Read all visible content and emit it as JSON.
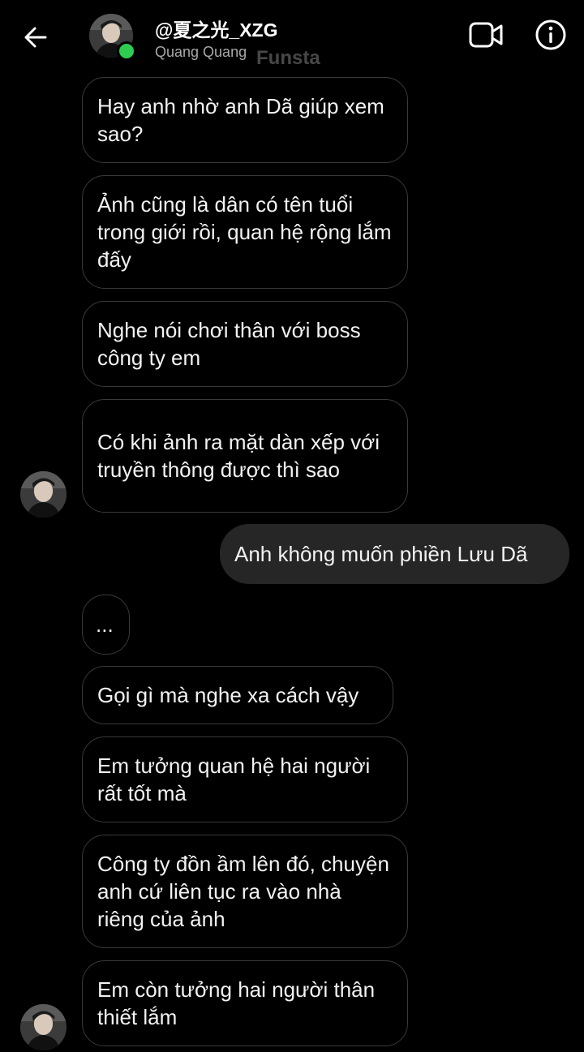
{
  "header": {
    "username": "@夏之光_XZG",
    "subtitle": "Quang Quang",
    "watermark": "Funsta",
    "back_icon": "arrow-left-icon",
    "video_icon": "video-camera-icon",
    "info_icon": "info-icon",
    "online_color": "#2ecc4f"
  },
  "messages": [
    {
      "side": "received",
      "text": "Hay anh nhờ anh Dã giúp xem sao?"
    },
    {
      "side": "received",
      "text": "Ảnh cũng là dân có tên tuổi trong giới rồi, quan hệ rộng lắm đấy"
    },
    {
      "side": "received",
      "text": "Nghe nói chơi thân với boss công ty em"
    },
    {
      "side": "received",
      "text": "Có khi ảnh ra mặt dàn xếp với truyền thông được thì sao"
    },
    {
      "side": "sent",
      "text": "Anh không muốn phiền Lưu Dã"
    },
    {
      "side": "received",
      "text": "..."
    },
    {
      "side": "received",
      "text": "Gọi gì mà nghe xa cách vậy"
    },
    {
      "side": "received",
      "text": "Em tưởng quan hệ hai người rất tốt mà"
    },
    {
      "side": "received",
      "text": "Công ty đồn ầm lên đó, chuyện anh cứ liên tục ra vào nhà riêng của ảnh"
    },
    {
      "side": "received",
      "text": "Em còn tưởng hai người thân thiết lắm"
    }
  ]
}
